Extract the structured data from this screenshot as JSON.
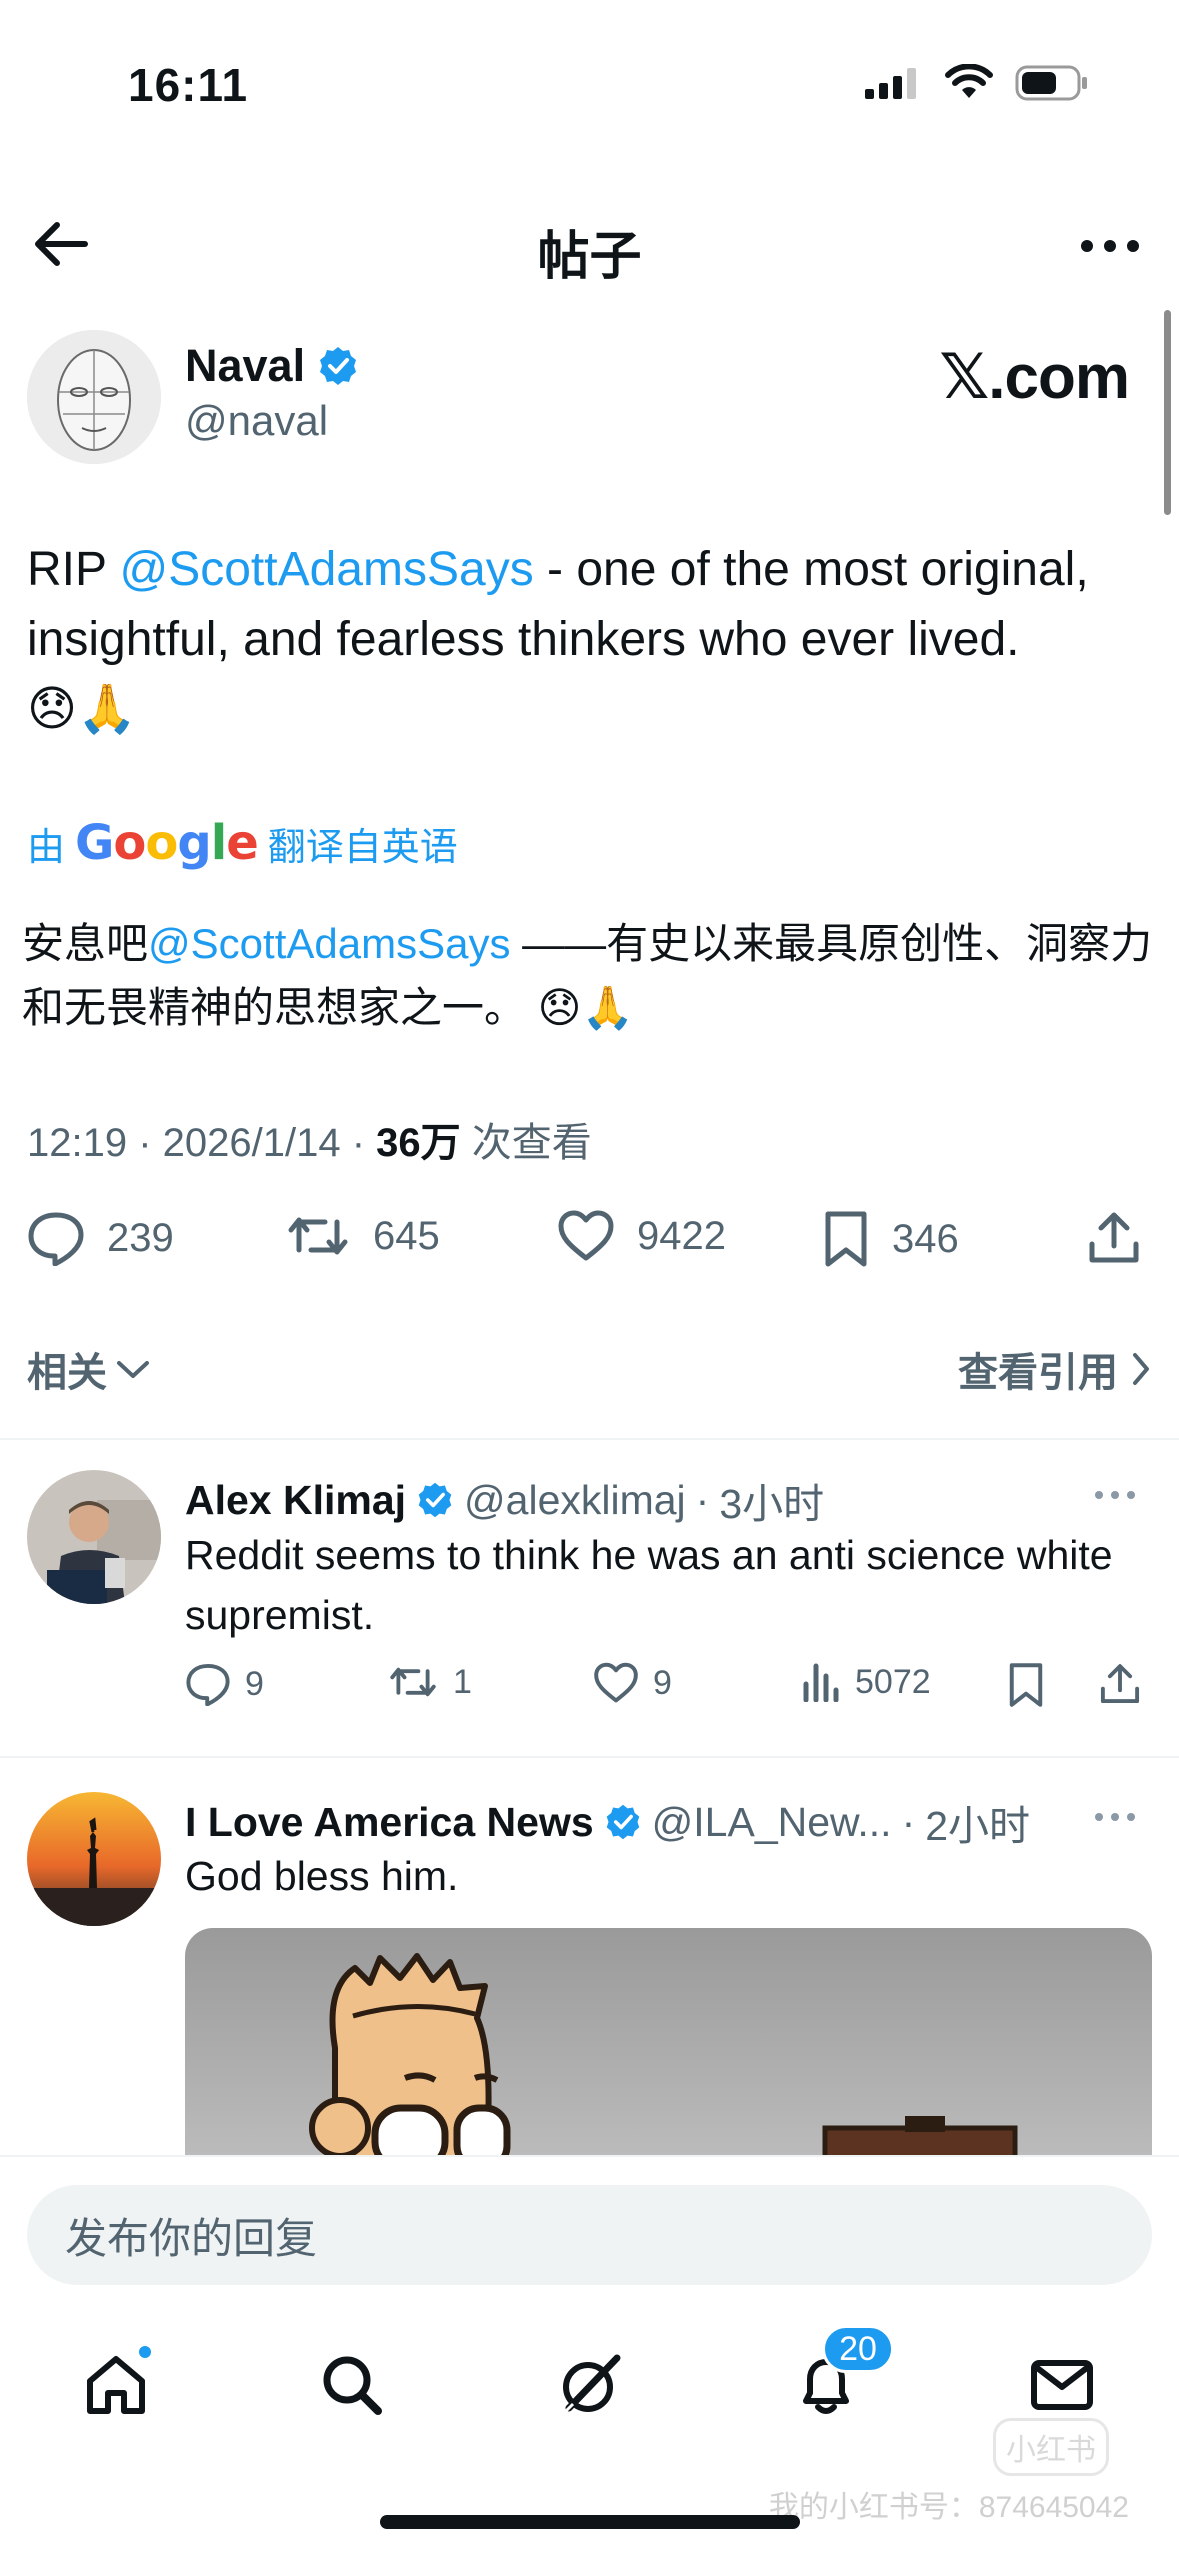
{
  "status_bar": {
    "time": "16:11"
  },
  "header": {
    "title": "帖子"
  },
  "post": {
    "author_name": "Naval",
    "author_handle": "@naval",
    "watermark_logo": "𝕏.com",
    "text_prefix": "RIP ",
    "mention": "@ScottAdamsSays",
    "text_suffix": " - one of the most original, insightful, and fearless thinkers who ever lived.",
    "emojis": "😞🙏",
    "translate_by": "由",
    "translate_google": "Google",
    "translate_label": "翻译自英语",
    "translated_prefix": "安息吧",
    "translated_mention": "@ScottAdamsSays",
    "translated_suffix": " ——有史以来最具原创性、洞察力和无畏精神的思想家之一。 ",
    "translated_emojis": "😞🙏",
    "time": "12:19",
    "date": "2026/1/14",
    "views": "36万",
    "views_label": "次查看",
    "replies": "239",
    "reposts": "645",
    "likes": "9422",
    "bookmarks": "346"
  },
  "related": {
    "left_label": "相关",
    "right_label": "查看引用"
  },
  "replies": [
    {
      "name": "Alex Klimaj",
      "handle": "@alexklimaj",
      "time": "3小时",
      "text": "Reddit seems to think he was an anti science white supremist.",
      "replies": "9",
      "reposts": "1",
      "likes": "9",
      "views": "5072"
    },
    {
      "name": "I Love America News",
      "handle": "@ILA_New...",
      "time": "2小时",
      "text": "God bless him."
    }
  ],
  "composer": {
    "placeholder": "发布你的回复"
  },
  "tab_bar": {
    "notifications_count": "20"
  },
  "watermark": {
    "text": "我的小红书号：874645042",
    "logo": "小红书"
  },
  "colors": {
    "accent": "#1d9bf0",
    "text": "#0f1419",
    "secondary": "#536471"
  }
}
